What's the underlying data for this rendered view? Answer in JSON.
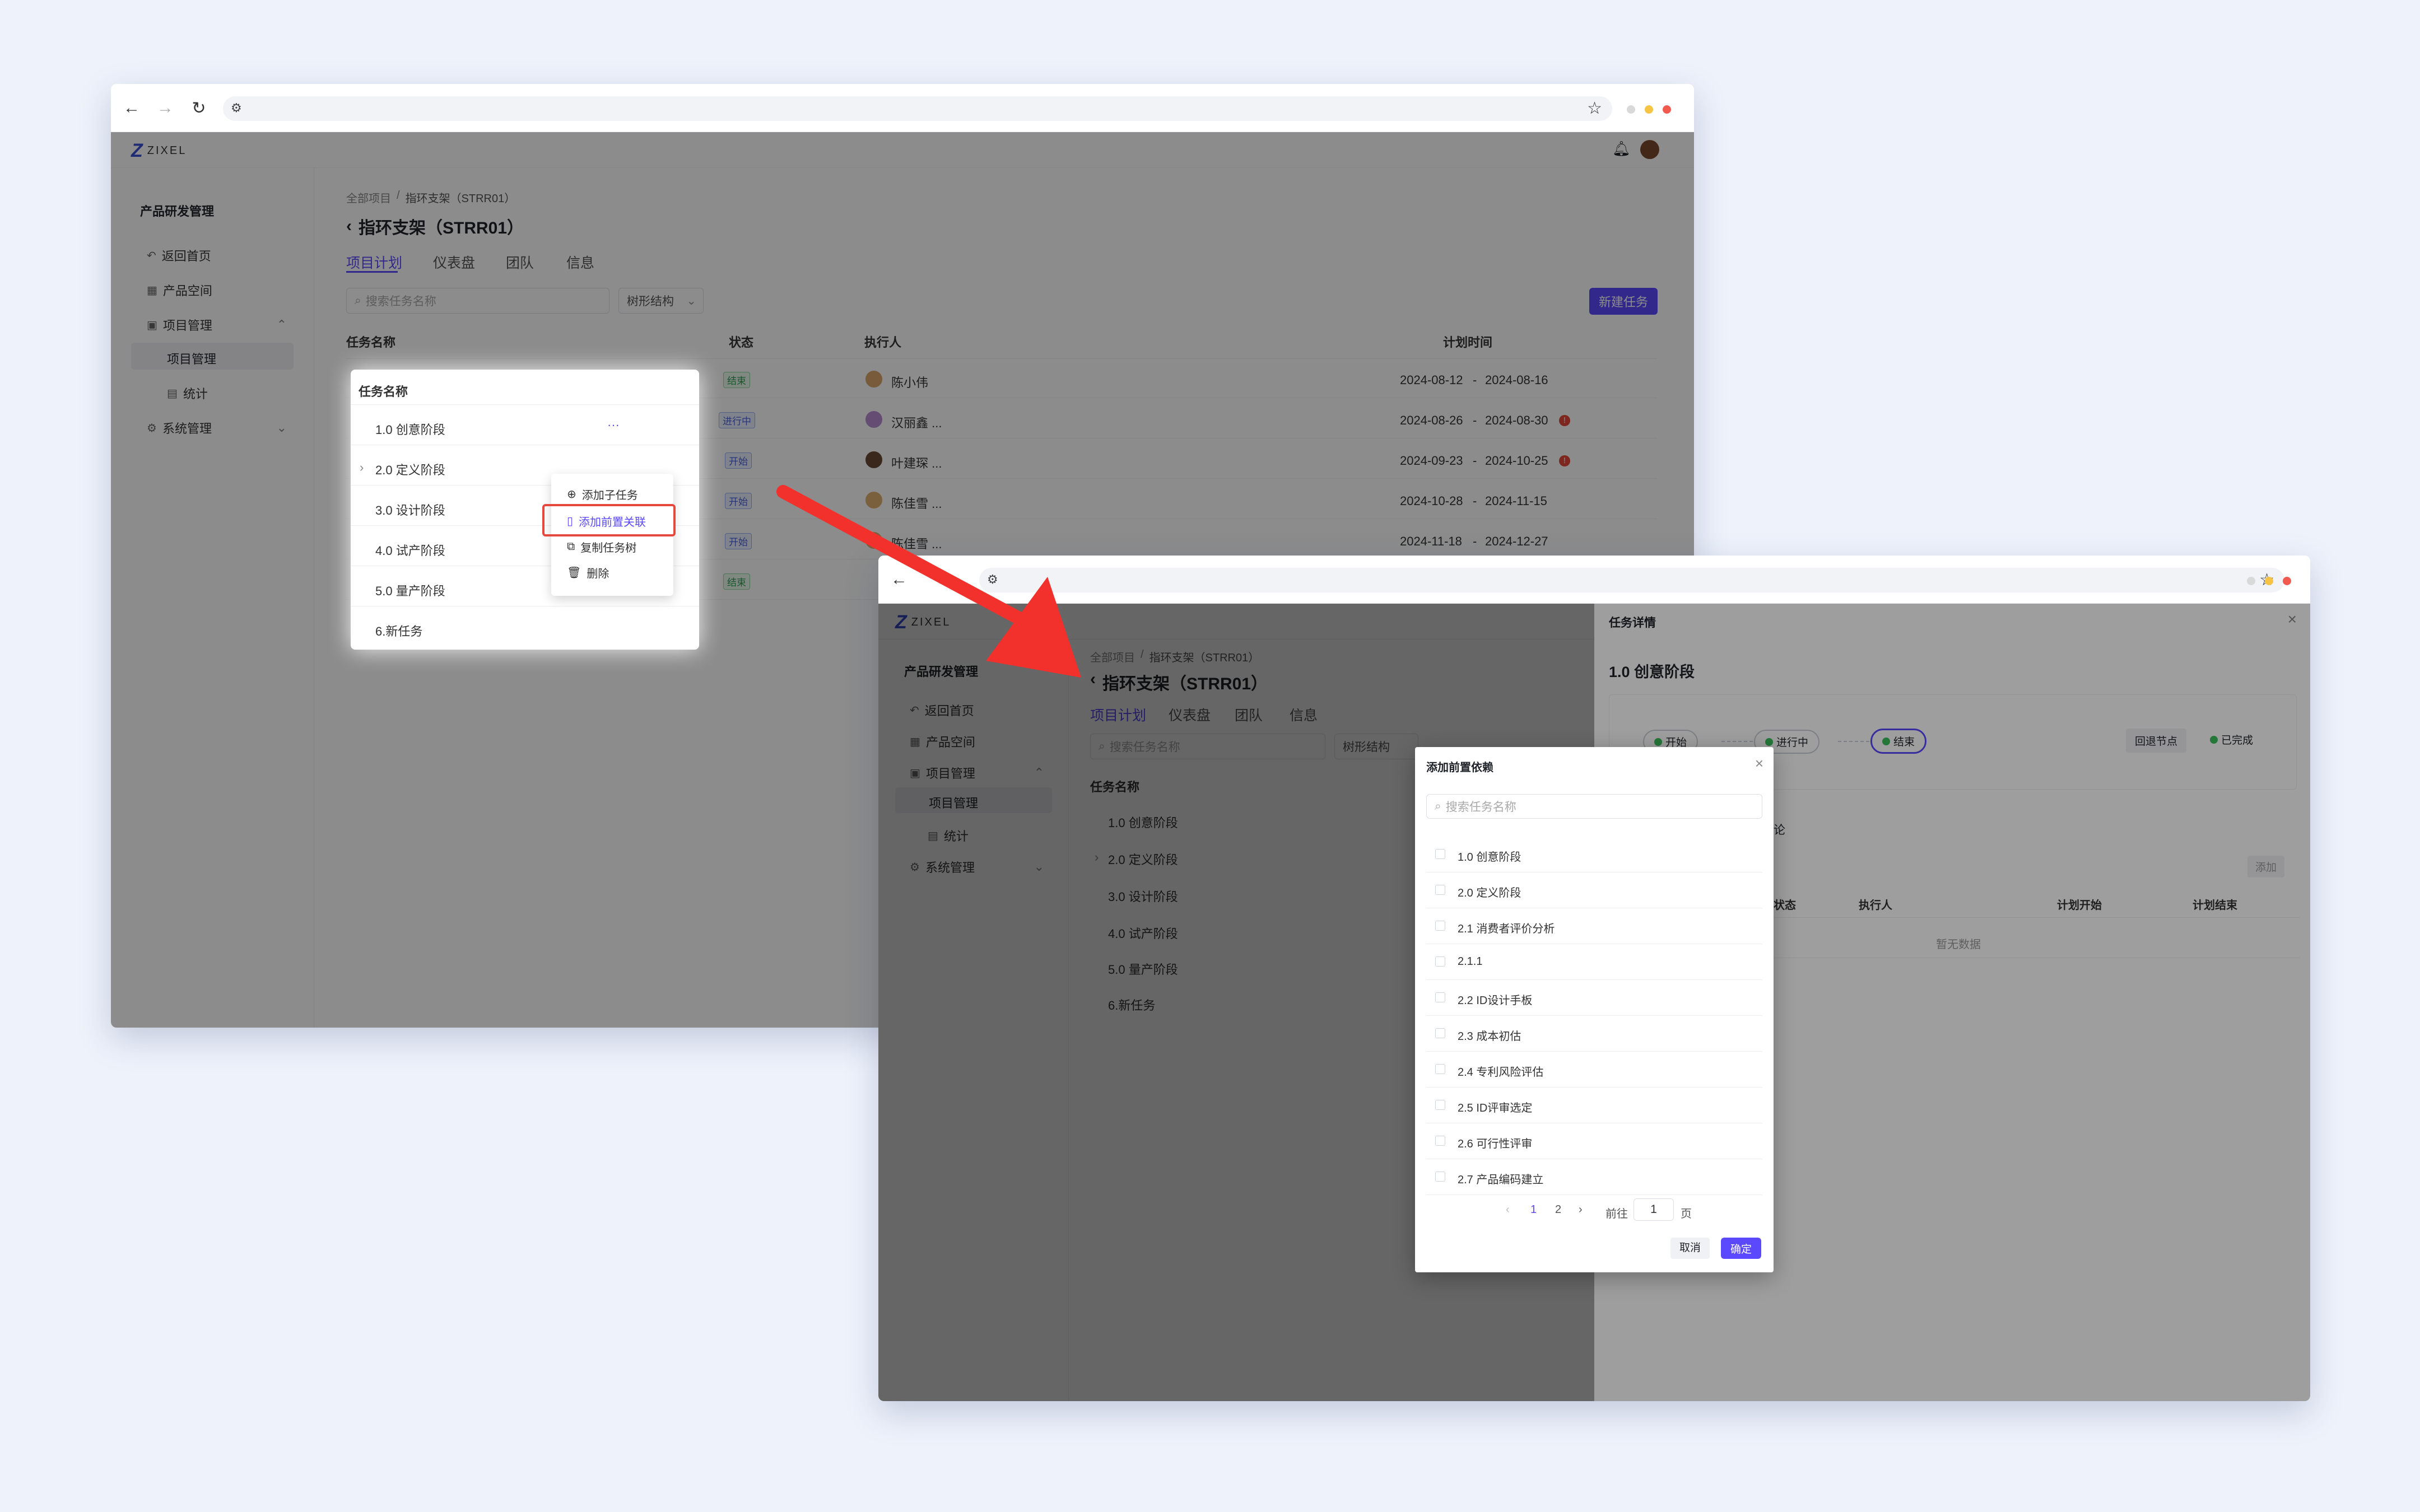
{
  "brand": {
    "logo_text": "ZIXEL"
  },
  "sidebar": {
    "title": "产品研发管理",
    "items": [
      {
        "label": "返回首页",
        "icon": "undo-icon"
      },
      {
        "label": "产品空间",
        "icon": "grid-icon"
      },
      {
        "label": "项目管理",
        "icon": "briefcase-icon"
      },
      {
        "label": "项目管理"
      },
      {
        "label": "统计",
        "icon": "chart-icon"
      },
      {
        "label": "系统管理",
        "icon": "gear-icon"
      }
    ]
  },
  "breadcrumb": {
    "root": "全部项目",
    "sep": "/",
    "current": "指环支架（STRR01）"
  },
  "page_title": "指环支架（STRR01）",
  "tabs": [
    "项目计划",
    "仪表盘",
    "团队",
    "信息"
  ],
  "search": {
    "placeholder": "搜索任务名称"
  },
  "view_select": {
    "value": "树形结构"
  },
  "new_task_label": "新建任务",
  "table": {
    "headers": {
      "name": "任务名称",
      "status": "状态",
      "assignee": "执行人",
      "time": "计划时间"
    },
    "rows": [
      {
        "name": "1.0 创意阶段",
        "status": "结束",
        "assignee": "陈小伟",
        "start": "2024-08-12",
        "end": "2024-08-16"
      },
      {
        "name": "2.0 定义阶段",
        "status": "进行中",
        "assignee": "汉丽鑫 ...",
        "start": "2024-08-26",
        "end": "2024-08-30"
      },
      {
        "name": "3.0 设计阶段",
        "status": "开始",
        "assignee": "叶建琛 ...",
        "start": "2024-09-23",
        "end": "2024-10-25"
      },
      {
        "name": "4.0 试产阶段",
        "status": "开始",
        "assignee": "陈佳雪 ...",
        "start": "2024-10-28",
        "end": "2024-11-15"
      },
      {
        "name": "5.0 量产阶段",
        "status": "开始",
        "assignee": "陈佳雪 ...",
        "start": "2024-11-18",
        "end": "2024-12-27"
      },
      {
        "name": "6.新任务",
        "status": "结束"
      }
    ],
    "date_sep": "-"
  },
  "more_icon": "···",
  "context_menu": [
    "添加子任务",
    "添加前置关联",
    "复制任务树",
    "删除"
  ],
  "drawer": {
    "title": "任务详情",
    "task_name": "1.0 创意阶段",
    "flow": [
      "开始",
      "进行中",
      "结束"
    ],
    "rollback_label": "回退节点",
    "completed_label": "已完成",
    "section_fragment": "论",
    "add_label": "添加",
    "headers": [
      "状态",
      "执行人",
      "计划开始",
      "计划结束"
    ],
    "empty": "暂无数据"
  },
  "dialog": {
    "title": "添加前置依赖",
    "search_placeholder": "搜索任务名称",
    "items": [
      "1.0 创意阶段",
      "2.0 定义阶段",
      "2.1 消费者评价分析",
      "2.1.1",
      "2.2 ID设计手板",
      "2.3 成本初估",
      "2.4 专利风险评估",
      "2.5 ID评审选定",
      "2.6 可行性评审",
      "2.7 产品编码建立"
    ],
    "pages": [
      "1",
      "2"
    ],
    "goto_label": "前往",
    "page_value": "1",
    "page_unit": "页",
    "cancel_label": "取消",
    "ok_label": "确定"
  },
  "colors": {
    "accent": "#5b49ff",
    "highlight": "#e5483c",
    "arrow": "#f2312c"
  }
}
